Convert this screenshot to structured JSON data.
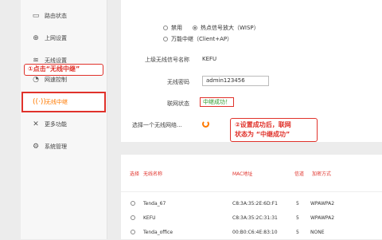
{
  "sidebar": {
    "items": [
      {
        "label": "路由状态",
        "icon": "router-icon"
      },
      {
        "label": "上网设置",
        "icon": "globe-icon"
      },
      {
        "label": "无线设置",
        "icon": "wifi-icon"
      },
      {
        "label": "网速控制",
        "icon": "speed-icon"
      },
      {
        "label": "无线中继",
        "icon": "repeater-icon"
      },
      {
        "label": "更多功能",
        "icon": "tools-icon"
      },
      {
        "label": "系统管理",
        "icon": "gear-icon"
      }
    ]
  },
  "callouts": {
    "c1": "①点击“无线中继”",
    "c2_line1": "②设置成功后，联网",
    "c2_line2": "状态为 “中继成功”"
  },
  "mode": {
    "opt1": "禁用",
    "opt2": "热点信号放大（WISP）",
    "opt3": "万能中继（Client+AP）",
    "selected": "opt2"
  },
  "form": {
    "ssid_label": "上级无线信号名称",
    "ssid_value": "KEFU",
    "pwd_label": "无线密码",
    "pwd_value": "admin123456",
    "status_label": "联网状态",
    "status_value": "中继成功！",
    "select_label": "选择一个无线网络..."
  },
  "table": {
    "headers": {
      "select": "选择",
      "name": "无线名称",
      "mac": "MAC地址",
      "channel": "信道",
      "enc": "加密方式"
    },
    "rows": [
      {
        "name": "Tenda_67",
        "mac": "C8:3A:35:2E:6D:F1",
        "channel": "5",
        "enc": "WPAWPA2"
      },
      {
        "name": "KEFU",
        "mac": "C8:3A:35:2C:31:31",
        "channel": "5",
        "enc": "WPAWPA2"
      },
      {
        "name": "Tenda_office",
        "mac": "00:B0:C6:4E:83:10",
        "channel": "5",
        "enc": "NONE"
      }
    ]
  },
  "colors": {
    "accent": "#ff7a00",
    "highlight": "#e0322b",
    "success": "#2a9a2a"
  }
}
